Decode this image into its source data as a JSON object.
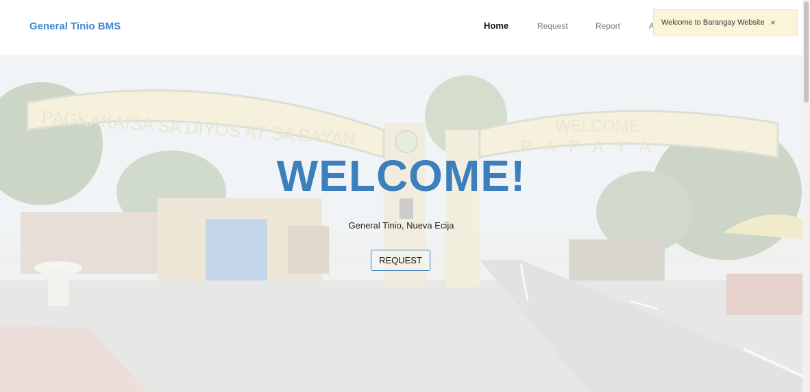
{
  "navbar": {
    "brand": "General Tinio BMS",
    "links": [
      {
        "label": "Home",
        "active": true
      },
      {
        "label": "Request",
        "active": false
      },
      {
        "label": "Report",
        "active": false
      },
      {
        "label": "A",
        "active": false
      }
    ]
  },
  "hero": {
    "title": "WELCOME!",
    "subtitle": "General Tinio, Nueva Ecija",
    "button_label": "REQUEST",
    "arch_left_text": "PAGKAKAISA SA DIYOS AT SA BAYAN",
    "arch_right_text_1": "WELCOME",
    "arch_right_text_2": "P A P A Y A"
  },
  "toast": {
    "message": "Welcome to Barangay Website",
    "close_symbol": "×"
  },
  "colors": {
    "brand": "#3f8ad0",
    "title": "#3d7fbd",
    "toast_bg": "#fcf4d9"
  }
}
